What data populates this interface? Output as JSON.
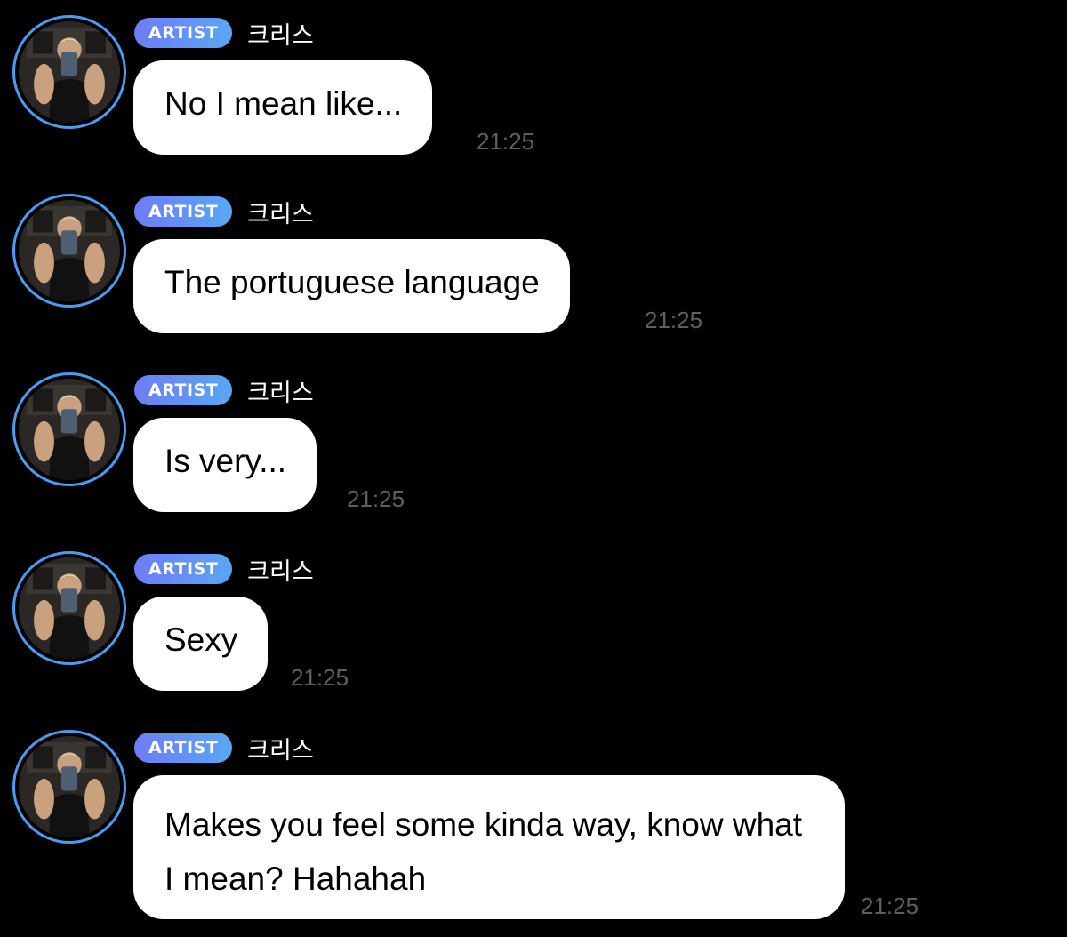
{
  "sender": {
    "badge": "ARTIST",
    "name": "크리스"
  },
  "messages": [
    {
      "text": "No I mean like...",
      "time": "21:25"
    },
    {
      "text": "The portuguese language",
      "time": "21:25"
    },
    {
      "text": "Is very...",
      "time": "21:25"
    },
    {
      "text": "Sexy",
      "time": "21:25"
    },
    {
      "text": "Makes you feel some kinda way, know what I mean? Hahahah",
      "time": "21:25"
    }
  ],
  "colors": {
    "background": "#000000",
    "avatar_ring": "#4b9cf0",
    "badge_gradient_start": "#6e7cf6",
    "badge_gradient_end": "#59a7f3",
    "bubble": "#ffffff",
    "timestamp": "#5f5f5f"
  }
}
